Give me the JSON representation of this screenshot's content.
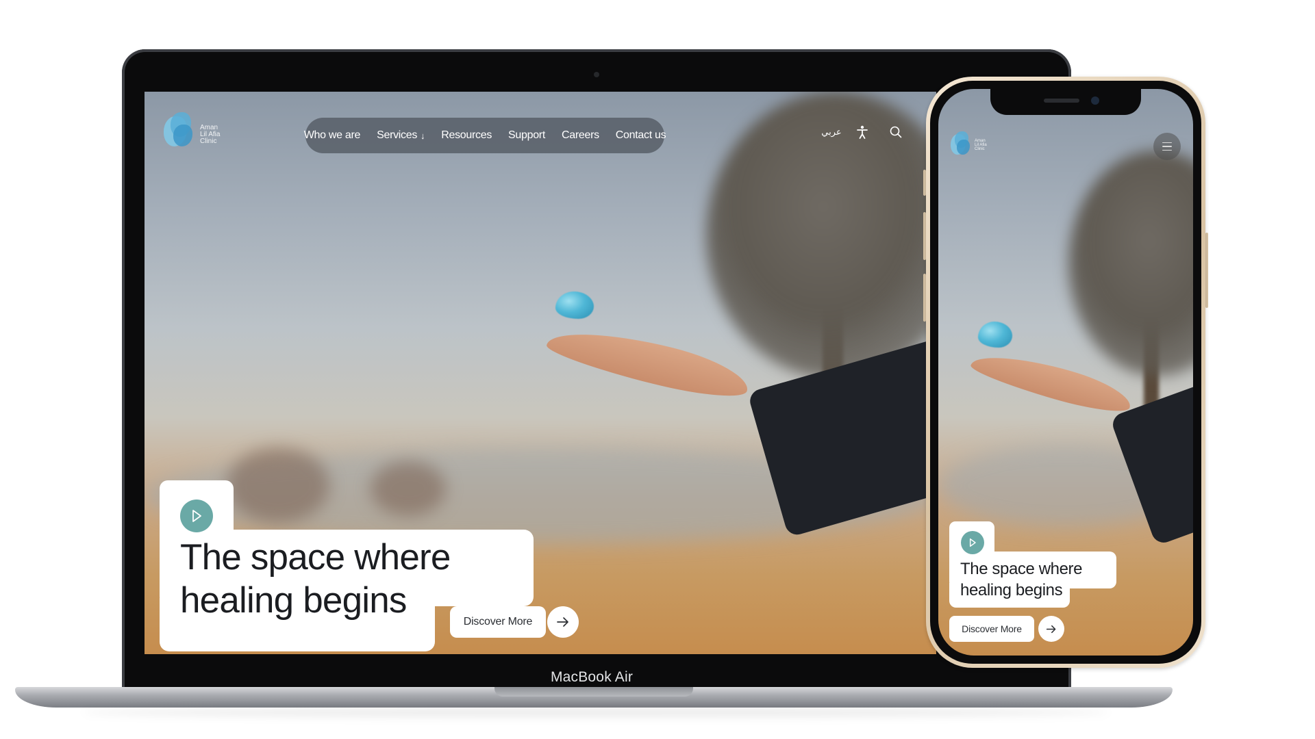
{
  "site": {
    "brand_lines": [
      "Aman",
      "Lil Afia",
      "Clinic"
    ],
    "nav": {
      "items": [
        {
          "label": "Who we are"
        },
        {
          "label": "Services",
          "caret": "↓"
        },
        {
          "label": "Resources"
        },
        {
          "label": "Support"
        },
        {
          "label": "Careers"
        },
        {
          "label": "Contact us"
        }
      ],
      "language_label": "عربي",
      "accessibility_icon": "accessibility-icon",
      "search_icon": "search-icon"
    },
    "hero": {
      "headline_line1": "The space where",
      "headline_line2": "healing begins",
      "cta_label": "Discover More",
      "play_icon": "play-icon",
      "arrow_icon": "arrow-right-icon"
    }
  },
  "device": {
    "laptop_label": "MacBook Air",
    "phone_menu_icon": "menu-icon"
  },
  "colors": {
    "accent_teal": "#6aa9a6",
    "nav_pill": "#525962",
    "logo_blue": "#4fb7d6"
  }
}
